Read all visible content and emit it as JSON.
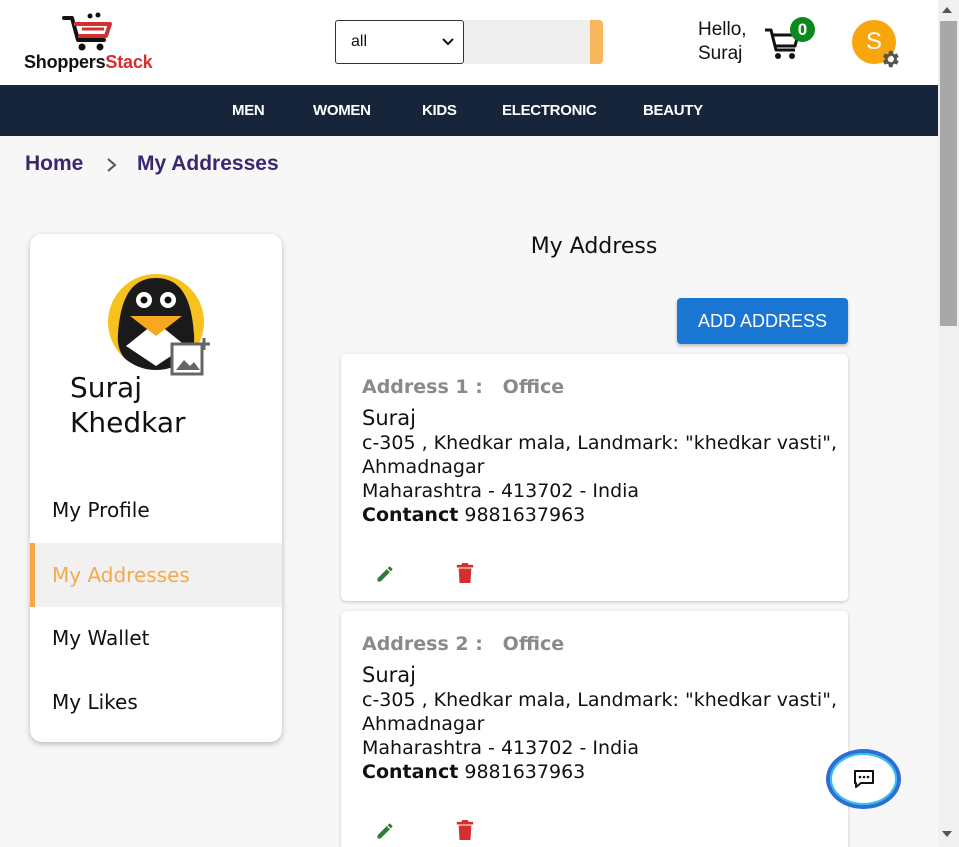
{
  "brand": {
    "name_part1": "Shoppers",
    "name_part2": "Stack",
    "accent": "#d32f2f"
  },
  "search": {
    "category_value": "all",
    "placeholder": ""
  },
  "user": {
    "greeting_line1": "Hello,",
    "greeting_line2": "Suraj",
    "avatar_initial": "S"
  },
  "cart": {
    "count": "0"
  },
  "nav": {
    "items": [
      "MEN",
      "WOMEN",
      "KIDS",
      "ELECTRONIC",
      "BEAUTY"
    ]
  },
  "breadcrumb": {
    "home": "Home",
    "current": "My Addresses"
  },
  "sidebar": {
    "name_line1": "Suraj",
    "name_line2": "Khedkar",
    "items": [
      "My Profile",
      "My Addresses",
      "My Wallet",
      "My Likes"
    ],
    "active_index": 1
  },
  "main": {
    "title": "My Address",
    "add_button": "ADD ADDRESS"
  },
  "addresses": [
    {
      "header": "Address 1 :   Office",
      "name": "Suraj",
      "line1": "c-305 , Khedkar mala, Landmark: \"khedkar vasti\",",
      "line2": "Ahmadnagar",
      "line3": "Maharashtra - 413702 - India",
      "contact_label": "Contanct",
      "contact_value": "9881637963"
    },
    {
      "header": "Address 2 :   Office",
      "name": "Suraj",
      "line1": "c-305 , Khedkar mala, Landmark: \"khedkar vasti\",",
      "line2": "Ahmadnagar",
      "line3": "Maharashtra - 413702 - India",
      "contact_label": "Contanct",
      "contact_value": "9881637963"
    }
  ],
  "colors": {
    "nav_bg": "#17253a",
    "accent_orange": "#f6a948",
    "primary_blue": "#1976d2",
    "success_green": "#0a8a1d",
    "danger_red": "#d32f2f"
  },
  "icons": [
    "cart-icon",
    "gear-icon",
    "chevron-right-icon",
    "add-photo-icon",
    "edit-icon",
    "delete-icon",
    "chat-icon"
  ]
}
